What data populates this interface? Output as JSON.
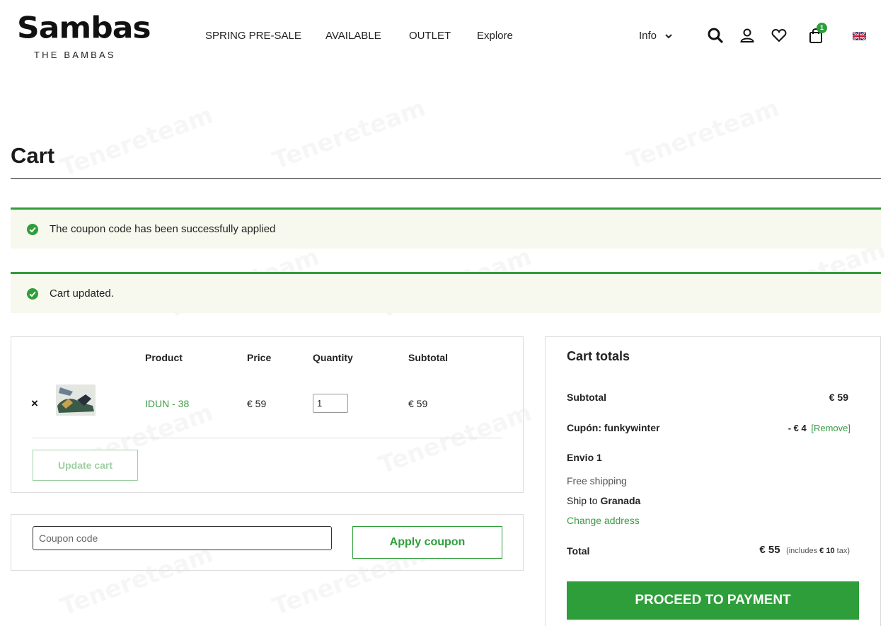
{
  "brand": {
    "logo_text": "Sambas",
    "logo_sub": "THE BAMBAS"
  },
  "nav": {
    "items": [
      "SPRING PRE-SALE",
      "AVAILABLE",
      "OUTLET",
      "Explore"
    ],
    "info_label": "Info",
    "cart_count": "1"
  },
  "watermark": "Tenereteam",
  "page": {
    "title": "Cart"
  },
  "notices": [
    "The coupon code has been successfully applied",
    "Cart updated."
  ],
  "cart_table": {
    "headers": {
      "product": "Product",
      "price": "Price",
      "quantity": "Quantity",
      "subtotal": "Subtotal"
    },
    "rows": [
      {
        "remove": "×",
        "product": "IDUN - 38",
        "price": "€ 59",
        "quantity": "1",
        "subtotal": "€ 59"
      }
    ],
    "update_label": "Update cart"
  },
  "coupon": {
    "placeholder": "Coupon code",
    "apply_label": "Apply coupon"
  },
  "totals": {
    "title": "Cart totals",
    "subtotal_label": "Subtotal",
    "subtotal_value": "€ 59",
    "coupon_label": "Cupón: funkywinter",
    "coupon_value": "- € 4",
    "coupon_remove": "[Remove]",
    "shipping_label": "Envio 1",
    "shipping_method": "Free shipping",
    "ship_to_prefix": "Ship to",
    "ship_to_city": "Granada",
    "change_address": "Change address",
    "total_label": "Total",
    "total_value": "€ 55",
    "tax_prefix": "(includes",
    "tax_value": "€ 10",
    "tax_suffix": "tax)",
    "proceed_label": "PROCEED TO PAYMENT"
  },
  "colors": {
    "accent": "#2e9e3a",
    "notice_bg": "#f7f8ee",
    "link": "#3a9a44"
  }
}
